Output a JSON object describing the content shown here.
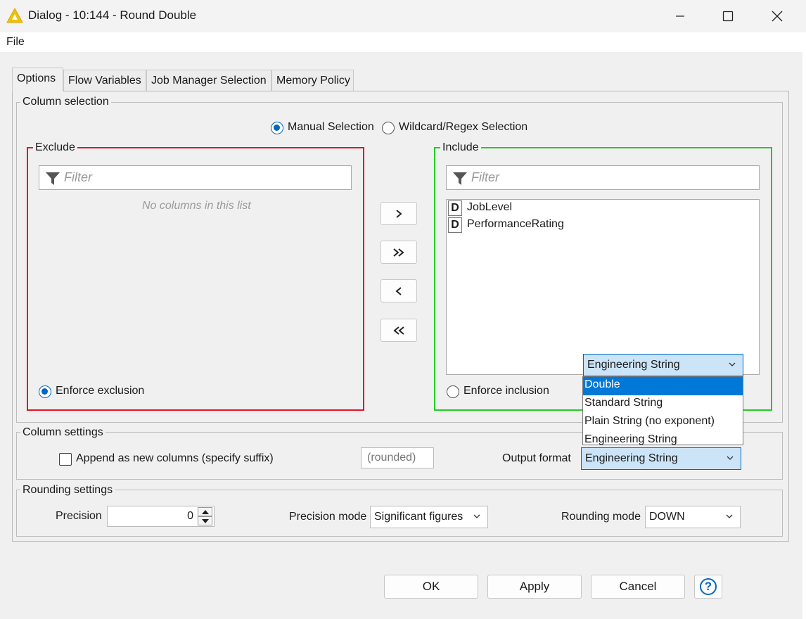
{
  "window": {
    "title": "Dialog - 10:144 - Round Double",
    "controls": {
      "minimize": "minimize",
      "maximize": "maximize",
      "close": "close"
    }
  },
  "menu": {
    "file": "File"
  },
  "tabs": [
    {
      "label": "Options",
      "active": true
    },
    {
      "label": "Flow Variables",
      "active": false
    },
    {
      "label": "Job Manager Selection",
      "active": false
    },
    {
      "label": "Memory Policy",
      "active": false
    }
  ],
  "column_selection": {
    "label": "Column selection",
    "manual_label": "Manual Selection",
    "manual_selected": true,
    "wildcard_label": "Wildcard/Regex Selection",
    "exclude": {
      "label": "Exclude",
      "filter_placeholder": "Filter",
      "empty_text": "No columns in this list",
      "enforce_label": "Enforce exclusion",
      "enforce_selected": true,
      "border_color": "#e81123"
    },
    "include": {
      "label": "Include",
      "filter_placeholder": "Filter",
      "columns": [
        {
          "type": "D",
          "name": "JobLevel"
        },
        {
          "type": "D",
          "name": "PerformanceRating"
        }
      ],
      "enforce_label": "Enforce inclusion",
      "enforce_selected": false,
      "border_color": "#22cc22"
    },
    "move_buttons": {
      "add": ">",
      "add_all": "»",
      "remove": "<",
      "remove_all": "«"
    }
  },
  "column_settings": {
    "label": "Column settings",
    "append_label": "Append as new columns (specify suffix)",
    "append_checked": false,
    "suffix_value": "(rounded)",
    "output_format_label": "Output format",
    "output_format_value": "Engineering String",
    "dropdown_open": true,
    "dropdown_header": "Engineering String",
    "dropdown_options": [
      "Double",
      "Standard String",
      "Plain String (no exponent)",
      "Engineering String"
    ],
    "dropdown_highlighted": "Double"
  },
  "rounding_settings": {
    "label": "Rounding settings",
    "precision_label": "Precision",
    "precision_value": "0",
    "precision_mode_label": "Precision mode",
    "precision_mode_value": "Significant figures",
    "rounding_mode_label": "Rounding mode",
    "rounding_mode_value": "DOWN"
  },
  "footer": {
    "ok": "OK",
    "apply": "Apply",
    "cancel": "Cancel",
    "help_icon": "?"
  },
  "colors": {
    "accent": "#0067c0",
    "dropdown_highlight": "#0078d7",
    "app_icon": "#f2c000"
  }
}
